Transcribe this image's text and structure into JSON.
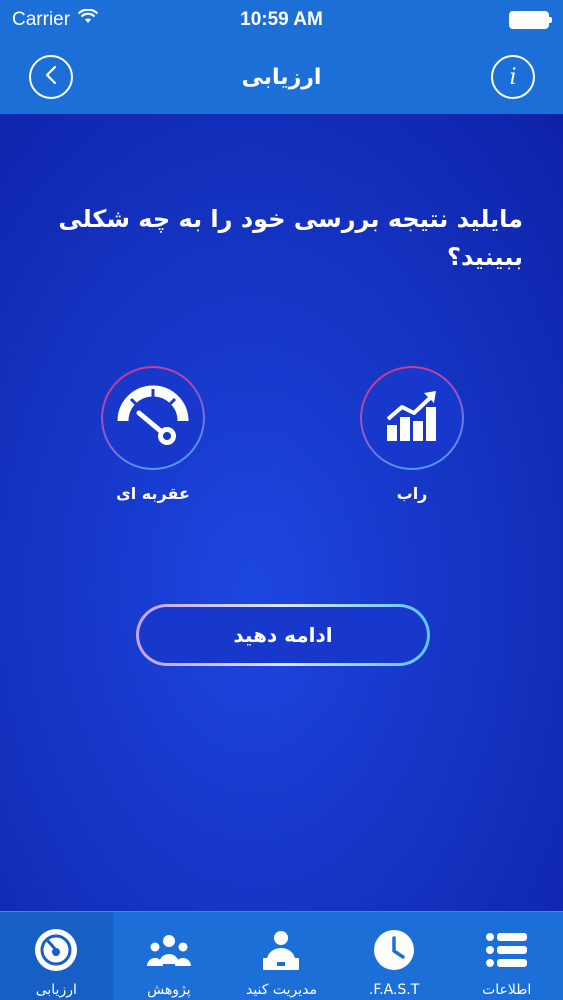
{
  "status_bar": {
    "carrier": "Carrier",
    "time": "10:59 AM"
  },
  "nav": {
    "title": "ارزیابی",
    "back_icon": "chevron-left-icon",
    "info_icon": "info-icon",
    "info_glyph": "i"
  },
  "question": "مایلید نتیجه بررسی خود را به چه شکلی ببینید؟",
  "options": [
    {
      "label": "عقربه ای",
      "icon": "gauge-icon"
    },
    {
      "label": "راب",
      "icon": "bar-chart-icon"
    }
  ],
  "continue_label": "ادامه دهید",
  "tabs": [
    {
      "label": "ارزیابی",
      "icon": "gauge-icon",
      "active": true
    },
    {
      "label": "پژوهش",
      "icon": "people-icon",
      "active": false
    },
    {
      "label": "مدیریت کنید",
      "icon": "manager-icon",
      "active": false
    },
    {
      "label": "F.A.S.T.",
      "icon": "clock-icon",
      "active": false
    },
    {
      "label": "اطلاعات",
      "icon": "list-icon",
      "active": false
    }
  ],
  "colors": {
    "bar": "#1d6fd8",
    "background": "#1a3fd0"
  }
}
